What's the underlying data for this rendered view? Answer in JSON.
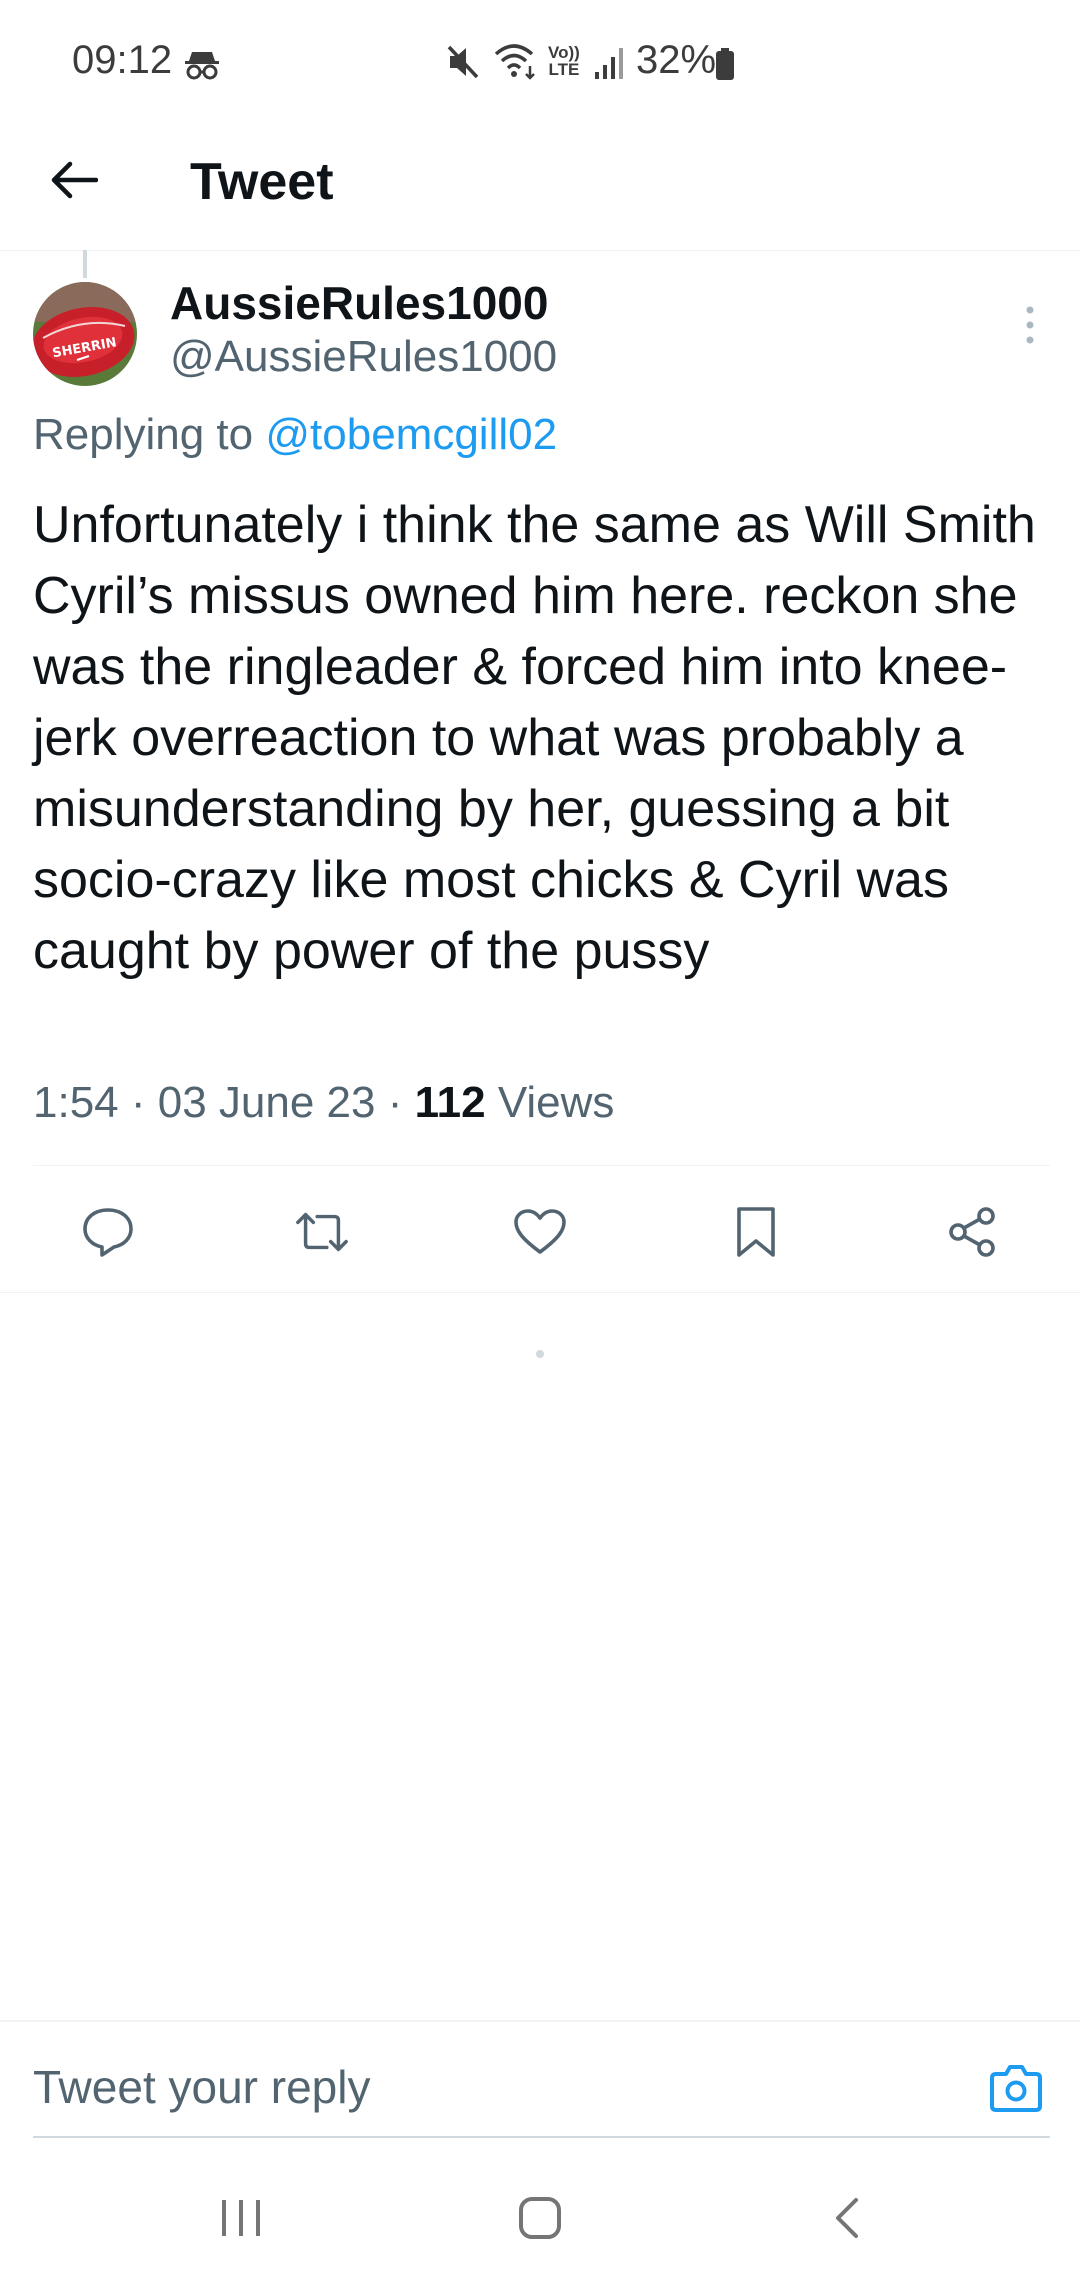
{
  "status_bar": {
    "time": "09:12",
    "incognito_icon": "incognito-icon",
    "volte_label_1": "Vo))",
    "volte_label_2": "LTE",
    "battery_pct": "32%"
  },
  "header": {
    "title": "Tweet",
    "back_icon": "arrow-left-icon"
  },
  "tweet": {
    "display_name": "AussieRules1000",
    "handle": "@AussieRules1000",
    "replying_prefix": "Replying to",
    "replying_to": "@tobemcgill02",
    "text": "Unfortunately i think the same as Will Smith Cyril’s missus owned him here. reckon she was the ringleader & forced him into knee-jerk overreaction to what was probably a misunderstanding by her, guessing a bit socio-crazy like most chicks & Cyril was caught by power of the pussy",
    "time": "1:54",
    "date": "03 June 23",
    "views_count": "112",
    "views_label": "Views"
  },
  "actions": [
    "reply-icon",
    "retweet-icon",
    "like-icon",
    "bookmark-icon",
    "share-icon"
  ],
  "reply_bar": {
    "placeholder": "Tweet your reply"
  },
  "colors": {
    "accent": "#1d9bf0",
    "text": "#0f1419",
    "secondary": "#536471",
    "divider": "#eff3f4"
  }
}
